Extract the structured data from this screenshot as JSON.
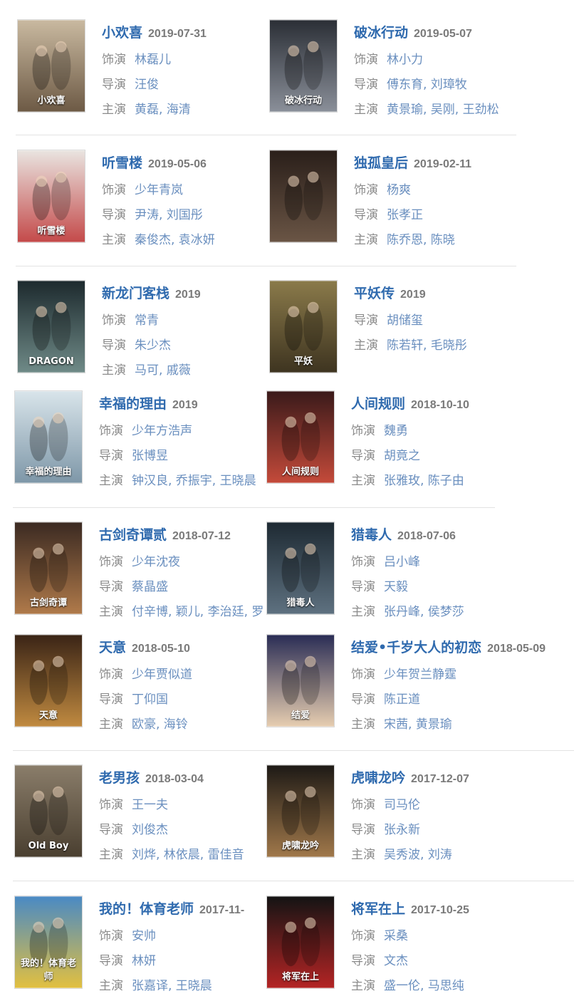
{
  "labels": {
    "role": "饰演",
    "director": "导演",
    "stars": "主演"
  },
  "items": [
    {
      "title": "小欢喜",
      "date": "2019-07-31",
      "role": "林磊儿",
      "director": "汪俊",
      "stars": "黄磊, 海清",
      "poster": "小欢喜"
    },
    {
      "title": "破冰行动",
      "date": "2019-05-07",
      "role": "林小力",
      "director": "傅东育, 刘璋牧",
      "stars": "黄景瑜, 吴刚, 王劲松",
      "poster": "破冰行动"
    },
    {
      "title": "听雪楼",
      "date": "2019-05-06",
      "role": "少年青岚",
      "director": "尹涛, 刘国彤",
      "stars": "秦俊杰, 袁冰妍",
      "poster": "听雪楼"
    },
    {
      "title": "独孤皇后",
      "date": "2019-02-11",
      "role": "杨爽",
      "director": "张孝正",
      "stars": "陈乔恩, 陈晓",
      "poster": ""
    },
    {
      "title": "新龙门客栈",
      "date": "2019",
      "role": "常青",
      "director": "朱少杰",
      "stars": "马可, 戚薇",
      "poster": "DRAGON"
    },
    {
      "title": "平妖传",
      "date": "2019",
      "director": "胡储玺",
      "stars": "陈若轩, 毛晓彤",
      "poster": "平妖"
    },
    {
      "title": "幸福的理由",
      "date": "2019",
      "role": "少年方浩声",
      "director": "张博昱",
      "stars": "钟汉良, 乔振宇, 王晓晨",
      "poster": "幸福的理由"
    },
    {
      "title": "人间规则",
      "date": "2018-10-10",
      "role": "魏勇",
      "director": "胡竟之",
      "stars": "张雅玫, 陈子由",
      "poster": "人间规则"
    },
    {
      "title": "古剑奇谭贰",
      "date": "2018-07-12",
      "role": "少年沈夜",
      "director": "蔡晶盛",
      "stars": "付辛博, 颖儿, 李治廷, 罗",
      "poster": "古剑奇谭"
    },
    {
      "title": "猎毒人",
      "date": "2018-07-06",
      "role": "吕小峰",
      "director": "天毅",
      "stars": "张丹峰, 侯梦莎",
      "poster": "猎毒人"
    },
    {
      "title": "天意",
      "date": "2018-05-10",
      "role": "少年贾似道",
      "director": "丁仰国",
      "stars": "欧豪, 海铃",
      "poster": "天意"
    },
    {
      "title": "结爱•千岁大人的初恋",
      "date": "2018-05-09",
      "role": "少年贺兰静霆",
      "director": "陈正道",
      "stars": "宋茜, 黄景瑜",
      "poster": "结爱"
    },
    {
      "title": "老男孩",
      "date": "2018-03-04",
      "role": "王一夫",
      "director": "刘俊杰",
      "stars": "刘烨, 林依晨, 雷佳音",
      "poster": "Old Boy"
    },
    {
      "title": "虎啸龙吟",
      "date": "2017-12-07",
      "role": "司马伦",
      "director": "张永新",
      "stars": "吴秀波, 刘涛",
      "poster": "虎啸龙吟"
    },
    {
      "title": "我的！体育老师",
      "date": "2017-11-",
      "role": "安帅",
      "director": "林妍",
      "stars": "张嘉译, 王晓晨",
      "poster": "我的！体育老师"
    },
    {
      "title": "将军在上",
      "date": "2017-10-25",
      "role": "采桑",
      "director": "文杰",
      "stars": "盛一伦, 马思纯",
      "poster": "将军在上"
    }
  ]
}
